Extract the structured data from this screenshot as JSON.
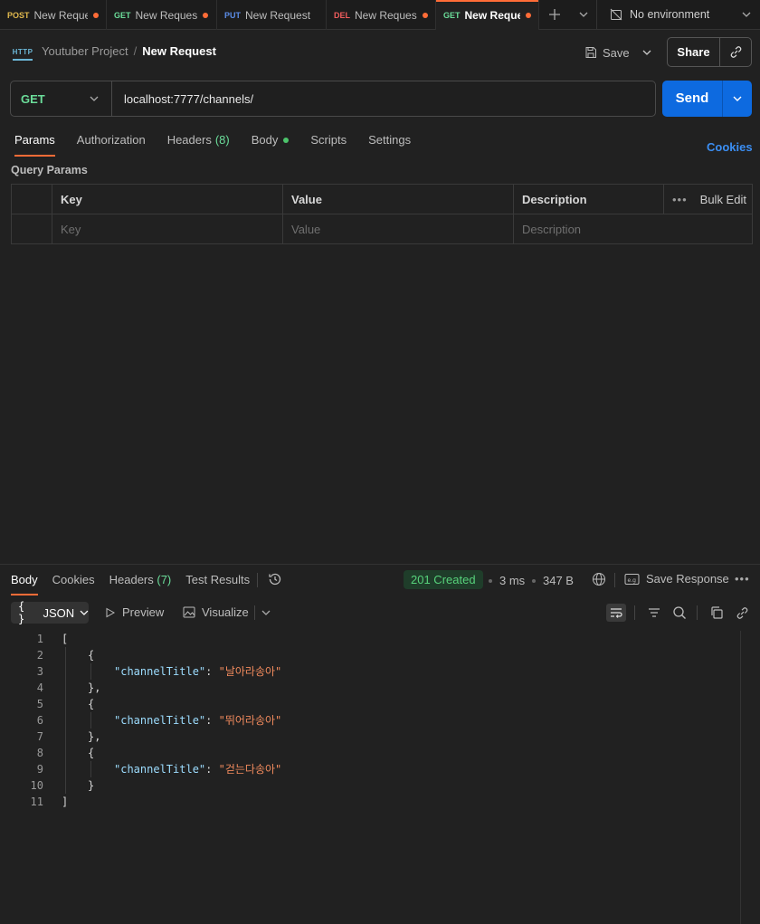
{
  "tabs": [
    {
      "method": "POST",
      "name": "New Reque:",
      "dirty": true
    },
    {
      "method": "GET",
      "name": "New Reques",
      "dirty": true
    },
    {
      "method": "PUT",
      "name": "New Request",
      "dirty": false
    },
    {
      "method": "DEL",
      "name": "New Reques",
      "dirty": true
    },
    {
      "method": "GET",
      "name": "New Reques",
      "dirty": true,
      "active": true
    }
  ],
  "environment": {
    "label": "No environment"
  },
  "breadcrumb": {
    "project": "Youtuber Project",
    "separator": "/",
    "request": "New Request",
    "icon": "http-icon"
  },
  "toolbar": {
    "save_label": "Save",
    "share_label": "Share"
  },
  "request": {
    "method": "GET",
    "url": "localhost:7777/channels/",
    "send_label": "Send"
  },
  "request_tabs": [
    {
      "label": "Params",
      "active": true
    },
    {
      "label": "Authorization"
    },
    {
      "label": "Headers",
      "count": "(8)"
    },
    {
      "label": "Body",
      "dot": true
    },
    {
      "label": "Scripts"
    },
    {
      "label": "Settings"
    }
  ],
  "cookies_label": "Cookies",
  "query_params": {
    "title": "Query Params",
    "headers": {
      "key": "Key",
      "value": "Value",
      "description": "Description",
      "bulk_edit": "Bulk Edit"
    },
    "placeholders": {
      "key": "Key",
      "value": "Value",
      "description": "Description"
    }
  },
  "response": {
    "tabs": [
      {
        "label": "Body",
        "active": true
      },
      {
        "label": "Cookies"
      },
      {
        "label": "Headers",
        "count": "(7)"
      },
      {
        "label": "Test Results"
      }
    ],
    "status": "201 Created",
    "time": "3 ms",
    "size": "347 B",
    "save_label": "Save Response",
    "format": "JSON",
    "preview_label": "Preview",
    "visualize_label": "Visualize",
    "lines": [
      {
        "n": "1",
        "indent": 0,
        "text": "["
      },
      {
        "n": "2",
        "indent": 1,
        "text": "{"
      },
      {
        "n": "3",
        "indent": 2,
        "key": "\"channelTitle\"",
        "value": "\"날아라송아\""
      },
      {
        "n": "4",
        "indent": 1,
        "text": "},"
      },
      {
        "n": "5",
        "indent": 1,
        "text": "{"
      },
      {
        "n": "6",
        "indent": 2,
        "key": "\"channelTitle\"",
        "value": "\"뛰어라송아\""
      },
      {
        "n": "7",
        "indent": 1,
        "text": "},"
      },
      {
        "n": "8",
        "indent": 1,
        "text": "{"
      },
      {
        "n": "9",
        "indent": 2,
        "key": "\"channelTitle\"",
        "value": "\"걷는다송아\""
      },
      {
        "n": "10",
        "indent": 1,
        "text": "}"
      },
      {
        "n": "11",
        "indent": 0,
        "text": "]"
      }
    ]
  },
  "colors": {
    "accent": "#ff6c37",
    "send": "#0d6ae0",
    "get": "#6bdd9a",
    "status_ok": "#57d27b"
  }
}
